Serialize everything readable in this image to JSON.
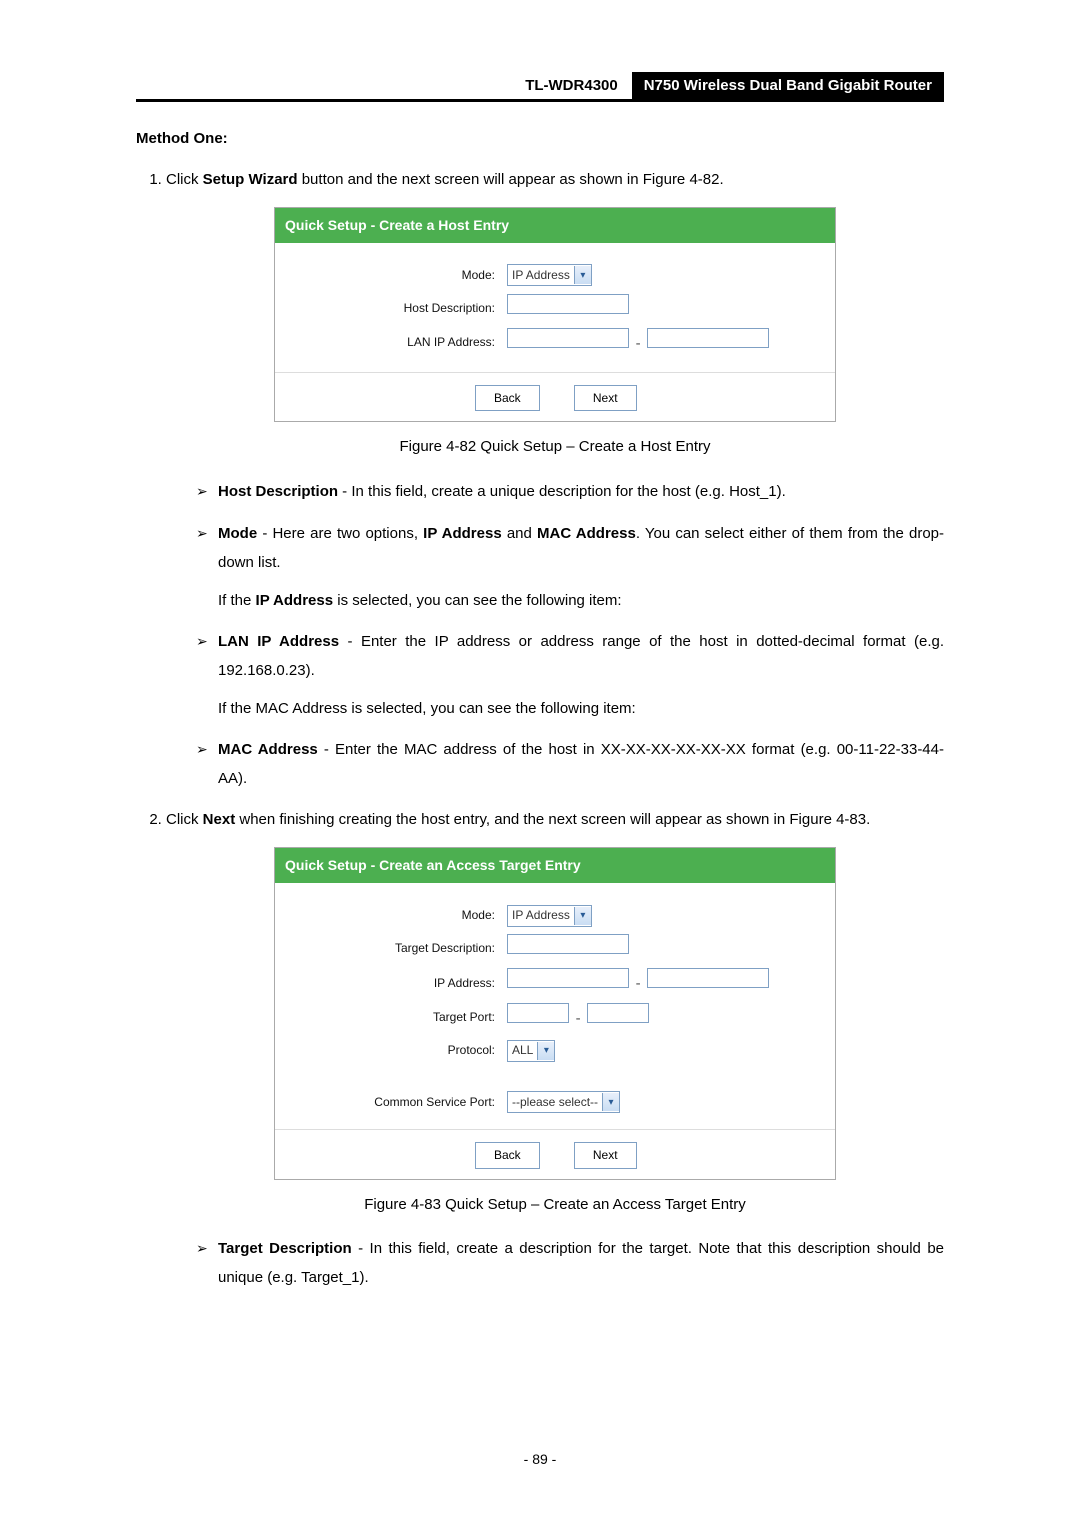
{
  "header": {
    "model": "TL-WDR4300",
    "title": "N750 Wireless Dual Band Gigabit Router"
  },
  "section_label": "Method One:",
  "step1": {
    "prefix": "Click ",
    "bold1": "Setup Wizard",
    "rest": " button and the next screen will appear as shown in Figure 4-82."
  },
  "panel1": {
    "title": "Quick Setup - Create a Host Entry",
    "mode_label": "Mode:",
    "mode_value": "IP Address",
    "hostdesc_label": "Host Description:",
    "lanip_label": "LAN IP Address:",
    "back_label": "Back",
    "next_label": "Next"
  },
  "caption1": "Figure 4-82 Quick Setup – Create a Host Entry",
  "bullets1": {
    "b1_bold": "Host Description",
    "b1_rest": " - In this field, create a unique description for the host (e.g. Host_1).",
    "b2_bold": "Mode",
    "b2_mid1": " - Here are two options, ",
    "b2_bold2": "IP Address",
    "b2_mid2": " and ",
    "b2_bold3": "MAC Address",
    "b2_rest": ". You can select either of them from the drop-down list.",
    "b2_sub_prefix": "If the ",
    "b2_sub_bold": "IP Address",
    "b2_sub_rest": " is selected, you can see the following item:",
    "b3_bold": "LAN IP Address",
    "b3_rest": " - Enter the IP address or address range of the host in dotted-decimal format (e.g. 192.168.0.23).",
    "b3_sub": "If the MAC Address is selected, you can see the following item:",
    "b4_bold": "MAC Address",
    "b4_rest": " - Enter the MAC address of the host in XX-XX-XX-XX-XX-XX format (e.g. 00-11-22-33-44-AA)."
  },
  "step2": {
    "prefix": "Click ",
    "bold1": "Next",
    "rest": " when finishing creating the host entry, and the next screen will appear as shown in Figure 4-83."
  },
  "panel2": {
    "title": "Quick Setup - Create an Access Target Entry",
    "mode_label": "Mode:",
    "mode_value": "IP Address",
    "targetdesc_label": "Target Description:",
    "ip_label": "IP Address:",
    "port_label": "Target Port:",
    "proto_label": "Protocol:",
    "proto_value": "ALL",
    "csp_label": "Common Service Port:",
    "csp_value": "--please select--",
    "back_label": "Back",
    "next_label": "Next"
  },
  "caption2": "Figure 4-83 Quick Setup – Create an Access Target Entry",
  "bullets2": {
    "b1_bold": "Target Description",
    "b1_rest": " - In this field, create a description for the target. Note that this description should be unique (e.g. Target_1)."
  },
  "page_number": "- 89 -"
}
